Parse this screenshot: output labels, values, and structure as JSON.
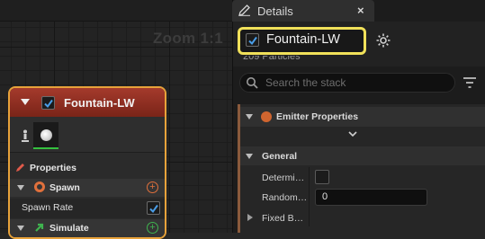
{
  "graph": {
    "zoom_label": "Zoom 1:1"
  },
  "node": {
    "title": "Fountain-LW",
    "properties_label": "Properties",
    "groups": [
      {
        "label": "Spawn",
        "color": "#e0703c"
      },
      {
        "label": "Simulate",
        "color": "#3fb34f"
      }
    ],
    "spawn_rate_label": "Spawn Rate",
    "outline_color": "#e7a23a",
    "header_color": "#a43a2c"
  },
  "details": {
    "tab_title": "Details",
    "close_glyph": "×",
    "emitter_name": "Fountain-LW",
    "highlight_color": "#f1e15a",
    "particles_text": "209 Particles",
    "search_placeholder": "Search the stack",
    "stack": {
      "section_label": "Emitter Properties",
      "category_label": "General",
      "properties": [
        {
          "label": "Determi…",
          "type": "checkbox",
          "checked": false
        },
        {
          "label": "Random…",
          "type": "number",
          "value": "0"
        },
        {
          "label": "Fixed B…",
          "type": "collapsed"
        }
      ]
    }
  }
}
